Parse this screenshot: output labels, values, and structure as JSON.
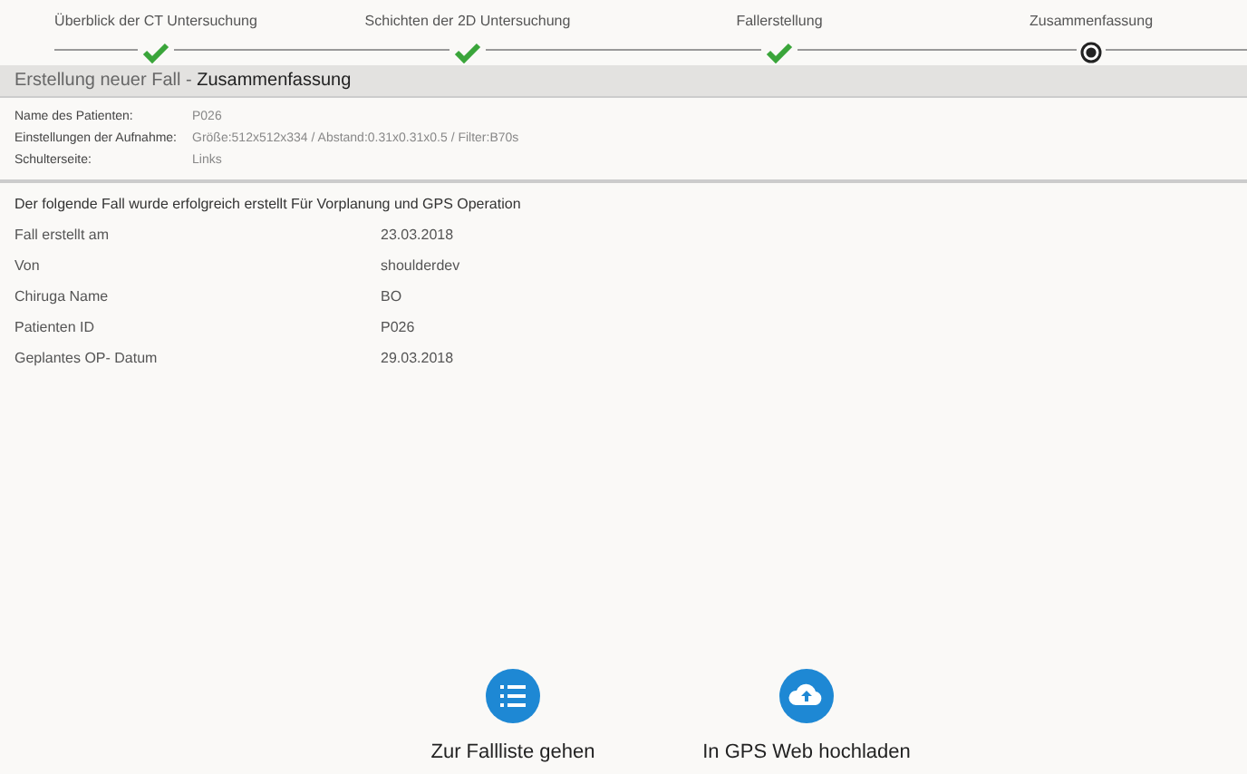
{
  "steps": [
    {
      "label": "Überblick der CT Untersuchung",
      "completed": true,
      "selected": false
    },
    {
      "label": "Schichten der 2D Untersuchung",
      "completed": true,
      "selected": false
    },
    {
      "label": "Fallerstellung",
      "completed": true,
      "selected": false
    },
    {
      "label": "Zusammenfassung",
      "completed": false,
      "selected": true
    }
  ],
  "header": {
    "prefix": "Erstellung neuer Fall - ",
    "title": "Zusammenfassung"
  },
  "info": [
    {
      "label": "Name des Patienten:",
      "value": "P026"
    },
    {
      "label": "Einstellungen der Aufnahme:",
      "value": "Größe:512x512x334 / Abstand:0.31x0.31x0.5 / Filter:B70s"
    },
    {
      "label": "Schulterseite:",
      "value": "Links"
    }
  ],
  "message": "Der folgende Fall wurde erfolgreich erstellt Für Vorplanung und GPS Operation",
  "details": [
    {
      "label": "Fall erstellt am",
      "value": "23.03.2018"
    },
    {
      "label": "Von",
      "value": "shoulderdev"
    },
    {
      "label": "Chiruga Name",
      "value": "BO"
    },
    {
      "label": "Patienten ID",
      "value": "P026"
    },
    {
      "label": "Geplantes OP- Datum",
      "value": "29.03.2018"
    }
  ],
  "actions": [
    {
      "kind": "list",
      "label": "Zur Fallliste gehen"
    },
    {
      "kind": "upload",
      "label": "In GPS Web hochladen"
    }
  ]
}
